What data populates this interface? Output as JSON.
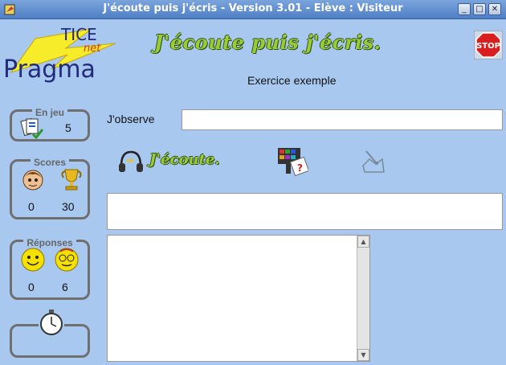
{
  "window": {
    "title": "J'écoute puis j'écris - Version 3.01 - Elève : Visiteur",
    "minimize": "_",
    "maximize": "□",
    "close": "✕"
  },
  "logo": {
    "line1": "TICE",
    "line2": "net",
    "line3": "Pragma"
  },
  "app_heading": "J'écoute puis j'écris.",
  "exercise_title": "Exercice exemple",
  "stop_label": "STOP",
  "panels": {
    "en_jeu": {
      "label": "En jeu",
      "value": "5"
    },
    "scores": {
      "label": "Scores",
      "student": "0",
      "trophy": "30"
    },
    "reponses": {
      "label": "Réponses",
      "correct": "0",
      "wrong": "6"
    }
  },
  "observe": {
    "label": "J'observe",
    "value": ""
  },
  "ecoute_label": "J'écoute.",
  "answer_field": {
    "value": ""
  },
  "textarea": {
    "value": ""
  },
  "icons": {
    "app": "app-icon",
    "cards": "cards-icon",
    "student": "student-face-icon",
    "trophy": "trophy-icon",
    "smiley_happy": "smiley-icon",
    "smiley_wink": "smiley-glasses-icon",
    "stopwatch": "stopwatch-icon",
    "headphones": "headphones-icon",
    "keyboard": "keyboard-icon",
    "write": "write-hand-icon"
  },
  "colors": {
    "background": "#a8c8f0",
    "heading_green": "#9acd32",
    "stop_red": "#d81e1e"
  }
}
